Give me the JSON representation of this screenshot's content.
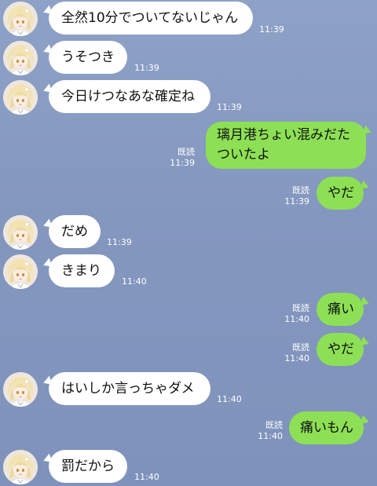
{
  "colors": {
    "background": "#8497bf",
    "incoming_bubble": "#ffffff",
    "outgoing_bubble": "#8de055",
    "meta_text": "#ffffff"
  },
  "avatar_icon": "blonde-character-avatar",
  "messages": [
    {
      "direction": "in",
      "text": "全然10分でついてないじゃん",
      "time": "11:39"
    },
    {
      "direction": "in",
      "text": "うそつき",
      "time": "11:39"
    },
    {
      "direction": "in",
      "text": "今日けつなあな確定ね",
      "time": "11:39"
    },
    {
      "direction": "out",
      "text": "璃月港ちょい混みだた\nついたよ",
      "time": "11:39",
      "read": "既読"
    },
    {
      "direction": "out",
      "text": "やだ",
      "time": "11:39",
      "read": "既読"
    },
    {
      "direction": "in",
      "text": "だめ",
      "time": "11:39"
    },
    {
      "direction": "in",
      "text": "きまり",
      "time": "11:40"
    },
    {
      "direction": "out",
      "text": "痛い",
      "time": "11:40",
      "read": "既読"
    },
    {
      "direction": "out",
      "text": "やだ",
      "time": "11:40",
      "read": "既読"
    },
    {
      "direction": "in",
      "text": "はいしか言っちゃダメ",
      "time": "11:40"
    },
    {
      "direction": "out",
      "text": "痛いもん",
      "time": "11:40",
      "read": "既読"
    },
    {
      "direction": "in",
      "text": "罰だから",
      "time": "11:40"
    }
  ]
}
